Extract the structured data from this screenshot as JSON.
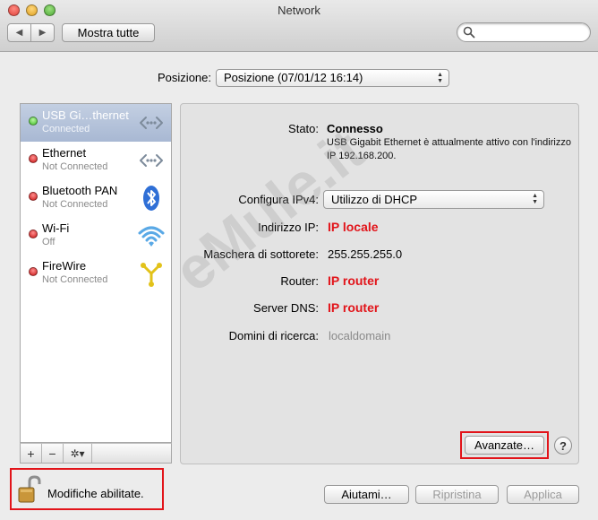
{
  "window": {
    "title": "Network"
  },
  "toolbar": {
    "back_glyph": "◀",
    "forward_glyph": "▶",
    "show_all_label": "Mostra tutte",
    "search_placeholder": ""
  },
  "location": {
    "label": "Posizione:",
    "value": "Posizione (07/01/12 16:14)"
  },
  "services": [
    {
      "name": "USB Gi…thernet",
      "status": "Connected",
      "dot": "green",
      "icon": "ethernet-icon",
      "selected": true
    },
    {
      "name": "Ethernet",
      "status": "Not Connected",
      "dot": "red",
      "icon": "ethernet-icon",
      "selected": false
    },
    {
      "name": "Bluetooth PAN",
      "status": "Not Connected",
      "dot": "red",
      "icon": "bluetooth-icon",
      "selected": false
    },
    {
      "name": "Wi-Fi",
      "status": "Off",
      "dot": "red",
      "icon": "wifi-icon",
      "selected": false
    },
    {
      "name": "FireWire",
      "status": "Not Connected",
      "dot": "red",
      "icon": "firewire-icon",
      "selected": false
    }
  ],
  "sidebar_bar": {
    "add": "+",
    "remove": "−",
    "gear": "✲▾"
  },
  "detail": {
    "status_label": "Stato:",
    "status_value": "Connesso",
    "status_desc": "USB Gigabit Ethernet è attualmente attivo con l'indirizzo  IP 192.168.200.",
    "ipv4_label": "Configura IPv4:",
    "ipv4_value": "Utilizzo di DHCP",
    "ip_label": "Indirizzo IP:",
    "ip_value": "IP locale",
    "mask_label": "Maschera di sottorete:",
    "mask_value": "255.255.255.0",
    "router_label": "Router:",
    "router_value": "IP router",
    "dns_label": "Server DNS:",
    "dns_value": "IP router",
    "domains_label": "Domini di ricerca:",
    "domains_value": "localdomain"
  },
  "buttons": {
    "advanced": "Avanzate…",
    "help": "?",
    "assist": "Aiutami…",
    "revert": "Ripristina",
    "apply": "Applica"
  },
  "lock": {
    "text": "Modifiche abilitate."
  },
  "watermark": "eMule.it",
  "colors": {
    "highlight": "#e2141a",
    "selection": "#a8b8d3",
    "status_green": "#3fbf2a",
    "status_red": "#c81414"
  }
}
